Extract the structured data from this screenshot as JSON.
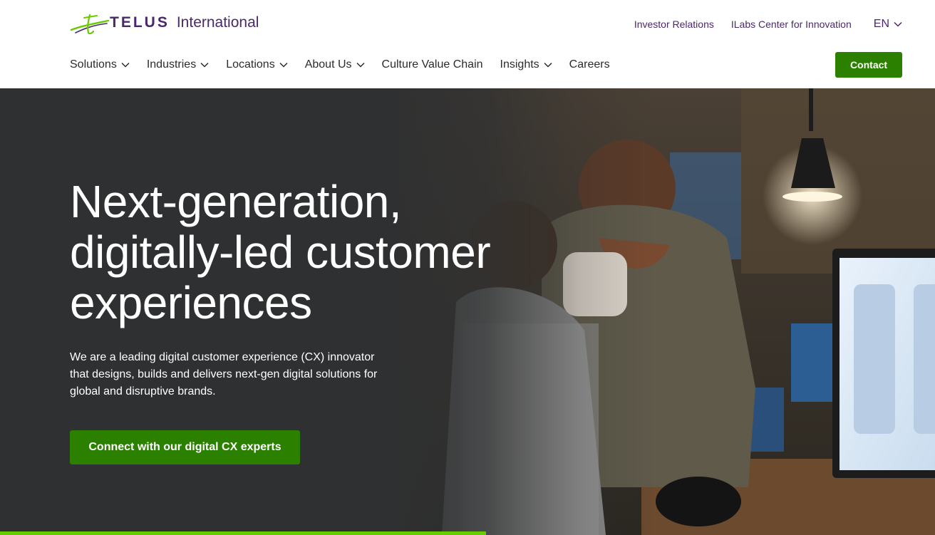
{
  "brand": {
    "wordmark": "TELUS",
    "subtitle": "International",
    "colors": {
      "purple": "#4b286d",
      "green": "#2b8000",
      "leaf": "#66cc00"
    }
  },
  "utility_nav": {
    "investor_relations": "Investor Relations",
    "ilabs": "ILabs Center for Innovation",
    "language": "EN"
  },
  "main_nav": {
    "items": [
      {
        "label": "Solutions",
        "has_dropdown": true
      },
      {
        "label": "Industries",
        "has_dropdown": true
      },
      {
        "label": "Locations",
        "has_dropdown": true
      },
      {
        "label": "About Us",
        "has_dropdown": true
      },
      {
        "label": "Culture Value Chain",
        "has_dropdown": false
      },
      {
        "label": "Insights",
        "has_dropdown": true
      },
      {
        "label": "Careers",
        "has_dropdown": false
      }
    ],
    "contact_label": "Contact"
  },
  "hero": {
    "title_line1": "Next-generation,",
    "title_line2": "digitally-led customer",
    "title_line3": "experiences",
    "text_line1": "We are a leading digital customer experience (CX) innovator",
    "text_line2": "that designs, builds and delivers next-gen digital solutions for",
    "text_line3": "global and disruptive brands.",
    "cta_label": "Connect with our digital CX experts",
    "image_description_icon": "office-photo-icon",
    "slide_progress": 0.52
  }
}
